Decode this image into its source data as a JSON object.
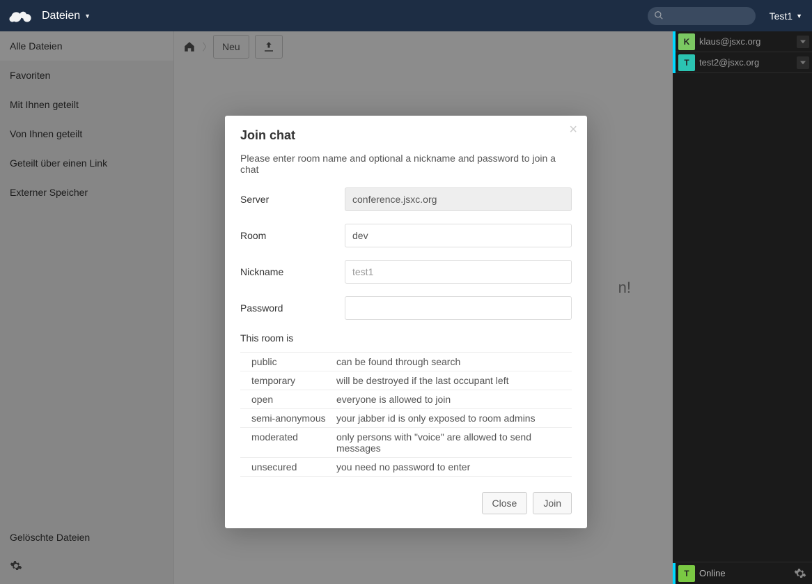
{
  "header": {
    "app_label": "Dateien",
    "search_placeholder": "",
    "user_label": "Test1"
  },
  "sidebar": {
    "items": [
      {
        "label": "Alle Dateien",
        "active": true
      },
      {
        "label": "Favoriten"
      },
      {
        "label": "Mit Ihnen geteilt"
      },
      {
        "label": "Von Ihnen geteilt"
      },
      {
        "label": "Geteilt über einen Link"
      },
      {
        "label": "Externer Speicher"
      }
    ],
    "deleted_label": "Gelöschte Dateien"
  },
  "controls": {
    "new_label": "Neu"
  },
  "bg_hint_fragment": "n!",
  "modal": {
    "title": "Join chat",
    "description": "Please enter room name and optional a nickname and password to join a chat",
    "labels": {
      "server": "Server",
      "room": "Room",
      "nickname": "Nickname",
      "password": "Password",
      "room_info": "This room is"
    },
    "values": {
      "server": "conference.jsxc.org",
      "room": "dev",
      "nickname_placeholder": "test1",
      "password": ""
    },
    "info": [
      {
        "k": "public",
        "v": "can be found through search"
      },
      {
        "k": "temporary",
        "v": "will be destroyed if the last occupant left"
      },
      {
        "k": "open",
        "v": "everyone is allowed to join"
      },
      {
        "k": "semi-anonymous",
        "v": "your jabber id is only exposed to room admins"
      },
      {
        "k": "moderated",
        "v": "only persons with \"voice\" are allowed to send messages"
      },
      {
        "k": "unsecured",
        "v": "you need no password to enter"
      }
    ],
    "buttons": {
      "close": "Close",
      "join": "Join"
    }
  },
  "chat": {
    "contacts": [
      {
        "initial": "K",
        "name": "klaus@jsxc.org",
        "avatar_class": "k"
      },
      {
        "initial": "T",
        "name": "test2@jsxc.org",
        "avatar_class": "t"
      }
    ],
    "self": {
      "initial": "T",
      "status": "Online"
    }
  }
}
